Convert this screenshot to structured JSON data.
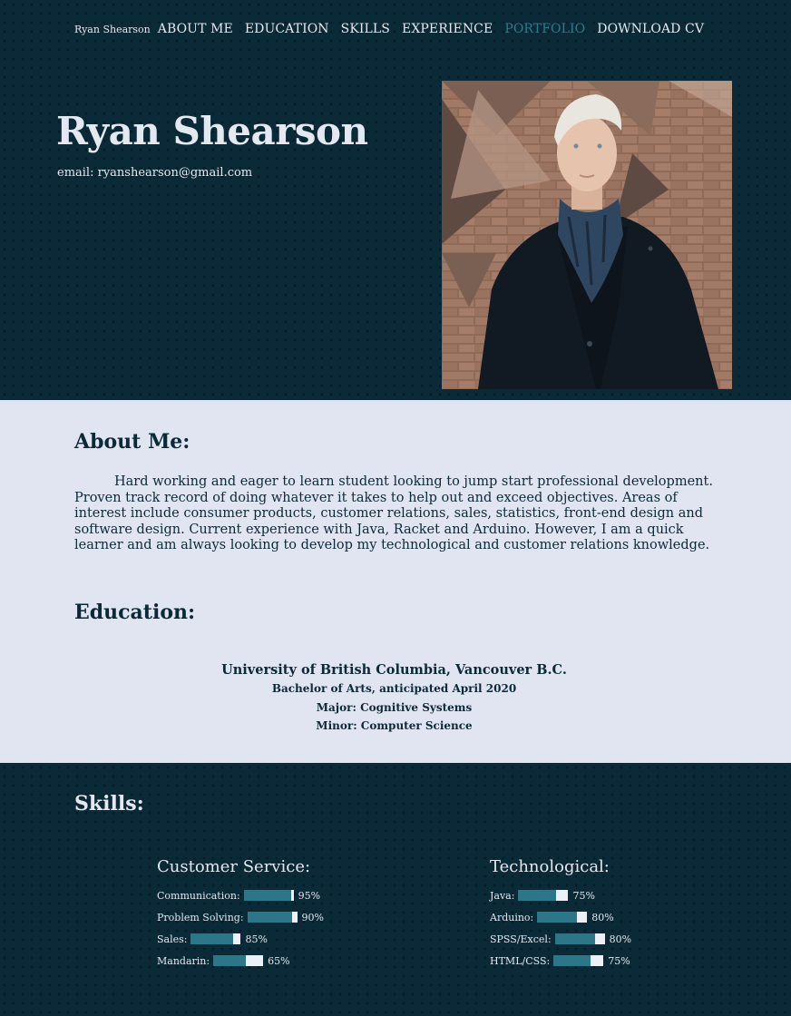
{
  "nav": {
    "brand": "Ryan Shearson",
    "items": [
      {
        "label": "ABOUT ME",
        "active": false
      },
      {
        "label": "EDUCATION",
        "active": false
      },
      {
        "label": "SKILLS",
        "active": false
      },
      {
        "label": "EXPERIENCE",
        "active": false
      },
      {
        "label": "PORTFOLIO",
        "active": true
      },
      {
        "label": "DOWNLOAD CV",
        "active": false
      }
    ]
  },
  "hero": {
    "name": "Ryan Shearson",
    "email": "email: ryanshearson@gmail.com"
  },
  "about": {
    "heading": "About Me:",
    "text": "Hard working and eager to learn student looking to jump start professional development. Proven track record of doing whatever it takes to help out and exceed objectives. Areas of interest include consumer products, customer relations, sales, statistics, front-end design and software design. Current experience with Java, Racket and Arduino. However, I am a quick learner and am always looking to develop my technological and customer relations knowledge."
  },
  "education": {
    "heading": "Education:",
    "school": "University of British Columbia, Vancouver B.C.",
    "degree": "Bachelor of Arts, anticipated April 2020",
    "major": "Major: Cognitive Systems",
    "minor": "Minor: Computer Science"
  },
  "skills": {
    "heading": "Skills:",
    "customer_service": {
      "title": "Customer Service:",
      "items": [
        {
          "label": "Communication:",
          "percent": 95,
          "value_text": "95%"
        },
        {
          "label": "Problem Solving:",
          "percent": 90,
          "value_text": "90%"
        },
        {
          "label": "Sales:",
          "percent": 85,
          "value_text": "85%"
        },
        {
          "label": "Mandarin:",
          "percent": 65,
          "value_text": "65%"
        }
      ]
    },
    "technological": {
      "title": "Technological:",
      "items": [
        {
          "label": "Java:",
          "percent": 75,
          "value_text": "75%"
        },
        {
          "label": "Arduino:",
          "percent": 80,
          "value_text": "80%"
        },
        {
          "label": "SPSS/Excel:",
          "percent": 80,
          "value_text": "80%"
        },
        {
          "label": "HTML/CSS:",
          "percent": 75,
          "value_text": "75%"
        }
      ]
    }
  },
  "colors": {
    "dark_bg": "#0b2a37",
    "light_bg": "#e1e4f1",
    "accent": "#2b7789",
    "active_nav": "#2f7b8e",
    "light_text": "#e4e8f1"
  }
}
